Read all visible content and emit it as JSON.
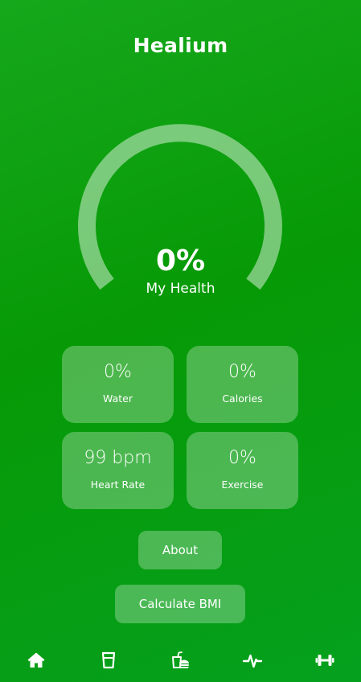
{
  "app": {
    "title": "Healium"
  },
  "health": {
    "value": "0%",
    "label": "My Health",
    "progress": 0
  },
  "stats": [
    {
      "value": "0%",
      "label": "Water"
    },
    {
      "value": "0%",
      "label": "Calories"
    },
    {
      "value": "99 bpm",
      "label": "Heart Rate"
    },
    {
      "value": "0%",
      "label": "Exercise"
    }
  ],
  "buttons": {
    "about": "About",
    "bmi": "Calculate BMI"
  },
  "nav": {
    "items": [
      {
        "icon": "home-icon"
      },
      {
        "icon": "water-glass-icon"
      },
      {
        "icon": "food-icon"
      },
      {
        "icon": "heartbeat-icon"
      },
      {
        "icon": "dumbbell-icon"
      }
    ]
  },
  "colors": {
    "background": "#079a06",
    "accent": "#ffffff"
  }
}
